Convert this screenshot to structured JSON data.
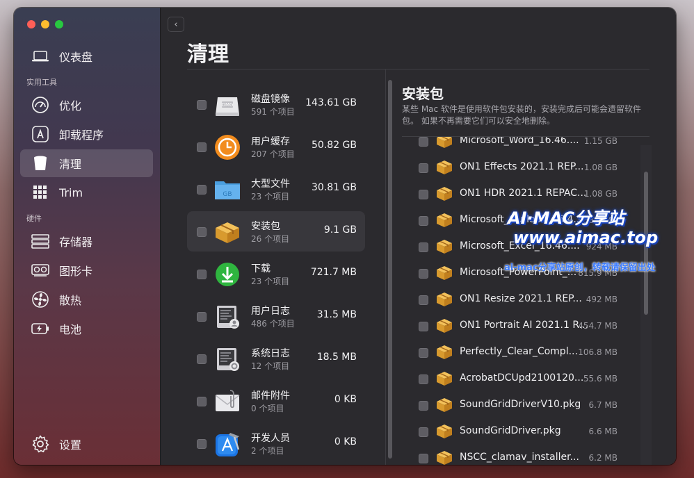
{
  "sidebar": {
    "top_item": {
      "label": "仪表盘",
      "icon": "laptop-icon"
    },
    "section1": "实用工具",
    "utility_items": [
      {
        "label": "优化",
        "icon": "gauge-icon"
      },
      {
        "label": "卸载程序",
        "icon": "app-store-icon"
      },
      {
        "label": "清理",
        "icon": "trash-bin-icon"
      },
      {
        "label": "Trim",
        "icon": "grid-icon"
      }
    ],
    "section2": "硬件",
    "hardware_items": [
      {
        "label": "存储器",
        "icon": "memory-icon"
      },
      {
        "label": "图形卡",
        "icon": "gpu-icon"
      },
      {
        "label": "散热",
        "icon": "fan-icon"
      },
      {
        "label": "电池",
        "icon": "battery-icon"
      }
    ],
    "settings": {
      "label": "设置",
      "icon": "gear-icon"
    }
  },
  "main": {
    "title": "清理",
    "categories": [
      {
        "name": "磁盘镜像",
        "count": "591 个项目",
        "size": "143.61 GB",
        "icon": "dmg-icon"
      },
      {
        "name": "用户缓存",
        "count": "207 个项目",
        "size": "50.82 GB",
        "icon": "cache-clock-icon"
      },
      {
        "name": "大型文件",
        "count": "23 个项目",
        "size": "30.81 GB",
        "icon": "folder-icon"
      },
      {
        "name": "安装包",
        "count": "26 个项目",
        "size": "9.1 GB",
        "icon": "package-icon"
      },
      {
        "name": "下载",
        "count": "23 个项目",
        "size": "721.7 MB",
        "icon": "download-icon"
      },
      {
        "name": "用户日志",
        "count": "486 个项目",
        "size": "31.5 MB",
        "icon": "user-log-icon"
      },
      {
        "name": "系统日志",
        "count": "12 个项目",
        "size": "18.5 MB",
        "icon": "system-log-icon"
      },
      {
        "name": "邮件附件",
        "count": "0 个项目",
        "size": "0 KB",
        "icon": "mail-attachment-icon"
      },
      {
        "name": "开发人员",
        "count": "2 个项目",
        "size": "0 KB",
        "icon": "xcode-icon"
      }
    ],
    "detail": {
      "title": "安装包",
      "description": "某些 Mac 软件是使用软件包安装的，安装完成后可能会遗留软件包。 如果不再需要它们可以安全地删除。",
      "files": [
        {
          "name": "Microsoft_Word_16.46....",
          "size": "1.15 GB"
        },
        {
          "name": "ON1 Effects 2021.1 REP...",
          "size": "1.08 GB"
        },
        {
          "name": "ON1 HDR 2021.1 REPAC...",
          "size": "1.08 GB"
        },
        {
          "name": "Microsoft_Outlook_16.4...",
          "size": "958.3 MB"
        },
        {
          "name": "Microsoft_Excel_16.46....",
          "size": "924 MB"
        },
        {
          "name": "Microsoft_PowerPoint_...",
          "size": "815.9 MB"
        },
        {
          "name": "ON1 Resize 2021.1 REP...",
          "size": "492 MB"
        },
        {
          "name": "ON1 Portrait AI 2021.1 R...",
          "size": "454.7 MB"
        },
        {
          "name": "Perfectly_Clear_Compl...",
          "size": "106.8 MB"
        },
        {
          "name": "AcrobatDCUpd2100120...",
          "size": "55.6 MB"
        },
        {
          "name": "SoundGridDriverV10.pkg",
          "size": "6.7 MB"
        },
        {
          "name": "SoundGridDriver.pkg",
          "size": "6.6 MB"
        },
        {
          "name": "NSCC_clamav_installer...",
          "size": "6.2 MB"
        }
      ]
    }
  },
  "watermark": {
    "line1": "AI·MAC分享站",
    "line2": "www.aimac.top",
    "line3": "ai-mac分享站原创，转载请保留出处"
  },
  "colors": {
    "accent_orange": "#f28c1e",
    "download_green": "#2fb53f",
    "window_bg": "#2b2a2e"
  }
}
